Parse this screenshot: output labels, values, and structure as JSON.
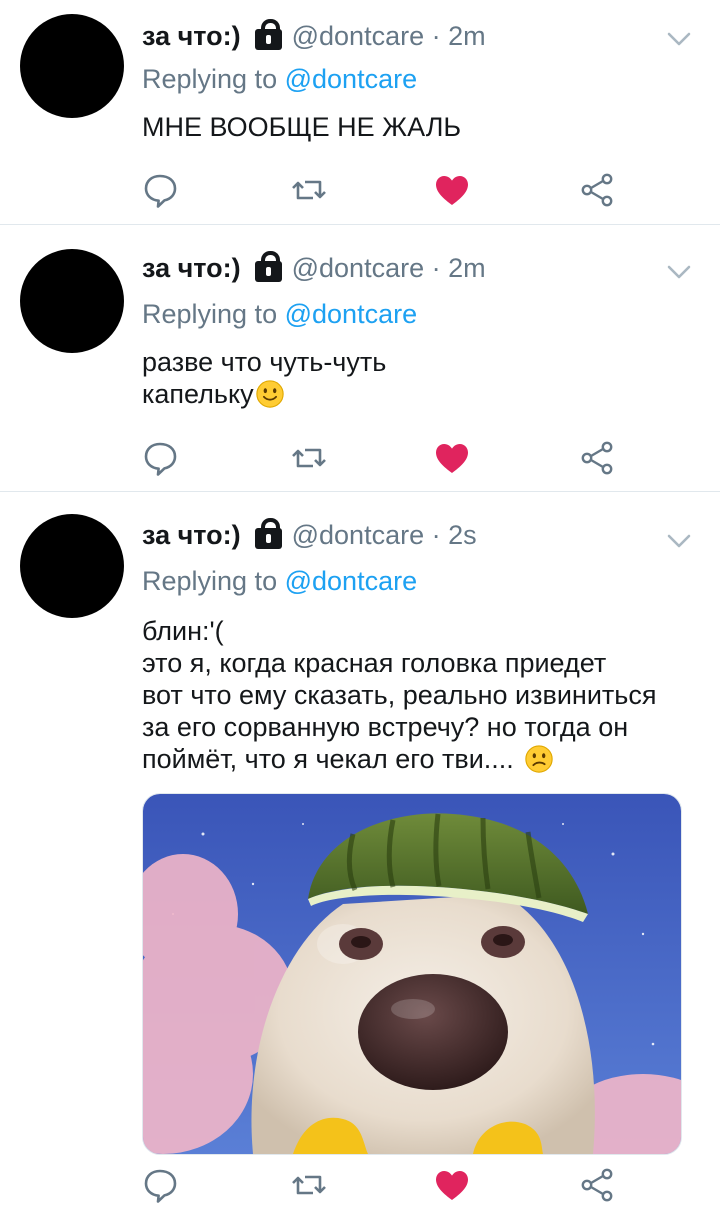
{
  "tweets": [
    {
      "name": "за что:)",
      "handle": "@dontcare",
      "time": "2m",
      "reply_prefix": "Replying to",
      "reply_handle": "@dontcare",
      "text": "МНЕ ВООБЩЕ НЕ ЖАЛЬ",
      "liked": true
    },
    {
      "name": "за что:)",
      "handle": "@dontcare",
      "time": "2m",
      "reply_prefix": "Replying to",
      "reply_handle": "@dontcare",
      "text_line1": "разве что чуть-чуть",
      "text_line2": "капельку",
      "emoji": "slightly-smiling-face",
      "liked": true
    },
    {
      "name": "за что:)",
      "handle": "@dontcare",
      "time": "2s",
      "reply_prefix": "Replying to",
      "reply_handle": "@dontcare",
      "text_lines": [
        "блин:'(",
        "это я, когда красная головка приедет",
        "вот что ему сказать, реально извиниться",
        "за его сорванную встречу? но тогда он",
        "поймёт, что я чекал его тви...."
      ],
      "emoji": "confused-face",
      "media": "photo of a white dog wearing a watermelon rind helmet against a starry blue sky with pink clouds",
      "liked": true
    }
  ],
  "icons": {
    "reply": "reply-icon",
    "retweet": "retweet-icon",
    "like": "heart-icon",
    "share": "share-icon",
    "caret": "chevron-down-icon",
    "protected": "lock-icon"
  },
  "colors": {
    "link": "#1da1f2",
    "secondary_text": "#657786",
    "like": "#e0245e",
    "icon": "#657786",
    "divider": "#e1e8ed"
  }
}
